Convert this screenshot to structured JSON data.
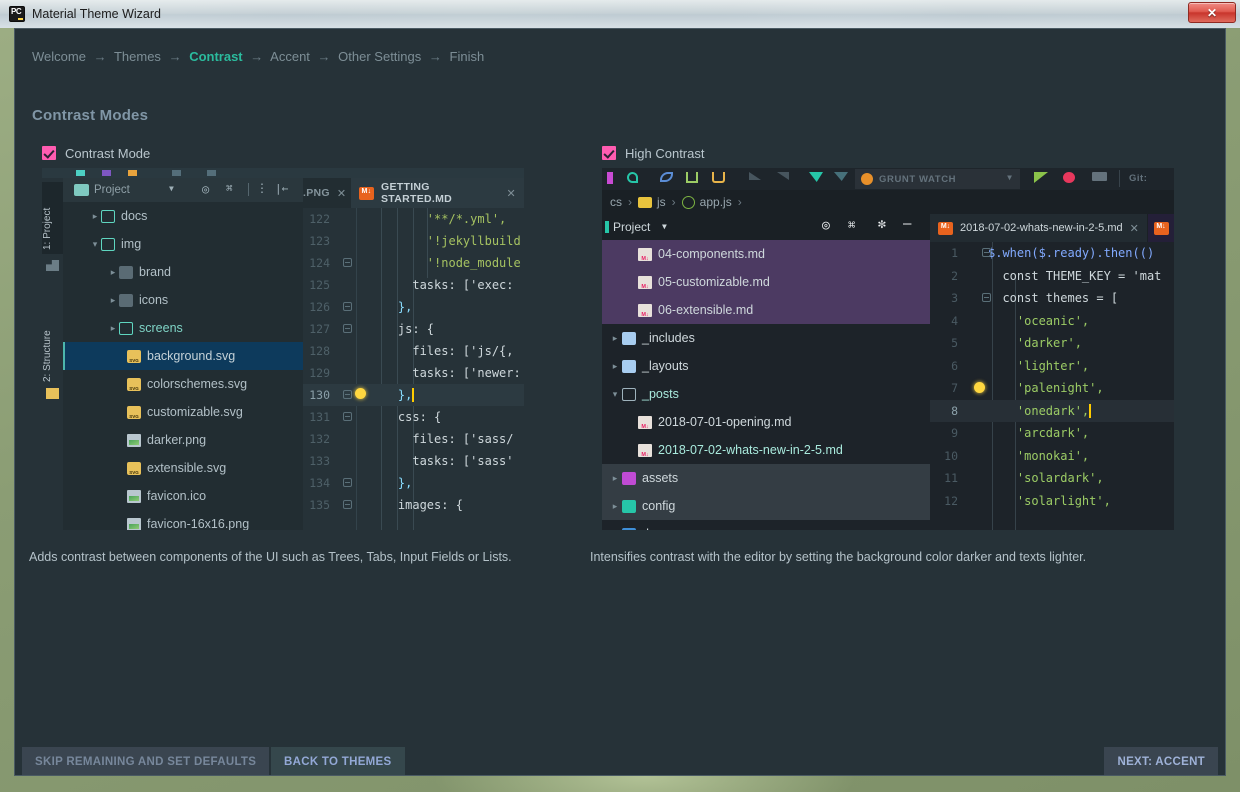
{
  "window": {
    "title": "Material Theme Wizard",
    "app_icon": "pycharm-icon",
    "close_label": "✕"
  },
  "breadcrumb": {
    "separator": "→",
    "steps": [
      {
        "label": "Welcome",
        "active": false
      },
      {
        "label": "Themes",
        "active": false
      },
      {
        "label": "Contrast",
        "active": true
      },
      {
        "label": "Accent",
        "active": false
      },
      {
        "label": "Other Settings",
        "active": false
      },
      {
        "label": "Finish",
        "active": false
      }
    ]
  },
  "page_title": "Contrast Modes",
  "options": [
    {
      "id": "contrast-mode",
      "label": "Contrast Mode",
      "checked": true,
      "description": "Adds contrast between components of the UI such as Trees, Tabs, Input Fields or Lists."
    },
    {
      "id": "high-contrast",
      "label": "High Contrast",
      "checked": true,
      "description": "Intensifies contrast with the editor by setting the background color darker and texts lighter."
    }
  ],
  "footer": {
    "skip": "SKIP REMAINING AND SET DEFAULTS",
    "back": "BACK TO THEMES",
    "next": "NEXT: ACCENT"
  },
  "preview_left": {
    "tool_window_tabs": [
      "1: Project",
      "2: Structure"
    ],
    "project_panel": {
      "title": "Project",
      "dropdown_icon": "chevron-down-icon",
      "toolbar_icons": [
        "target-icon",
        "collapse-all-icon",
        "more-options-icon",
        "hide-icon"
      ],
      "tree": [
        {
          "name": "docs",
          "arrow": "▸",
          "icon": "folder-outline-teal",
          "indent": 1,
          "selected": false
        },
        {
          "name": "img",
          "arrow": "▾",
          "icon": "folder-outline-teal",
          "indent": 1,
          "selected": false
        },
        {
          "name": "brand",
          "arrow": "▸",
          "icon": "folder-solid-grey",
          "indent": 2,
          "selected": false
        },
        {
          "name": "icons",
          "arrow": "▸",
          "icon": "folder-solid-grey",
          "indent": 2,
          "selected": false
        },
        {
          "name": "screens",
          "arrow": "▸",
          "icon": "folder-outline-teal",
          "indent": 2,
          "selected": false
        },
        {
          "name": "background.svg",
          "arrow": "",
          "icon": "svg-file-icon",
          "indent": 3,
          "selected": true
        },
        {
          "name": "colorschemes.svg",
          "arrow": "",
          "icon": "svg-file-icon",
          "indent": 3,
          "selected": false
        },
        {
          "name": "customizable.svg",
          "arrow": "",
          "icon": "svg-file-icon",
          "indent": 3,
          "selected": false
        },
        {
          "name": "darker.png",
          "arrow": "",
          "icon": "image-file-icon",
          "indent": 3,
          "selected": false
        },
        {
          "name": "extensible.svg",
          "arrow": "",
          "icon": "svg-file-icon",
          "indent": 3,
          "selected": false
        },
        {
          "name": "favicon.ico",
          "arrow": "",
          "icon": "image-file-icon",
          "indent": 3,
          "selected": false
        },
        {
          "name": "favicon-16x16.png",
          "arrow": "",
          "icon": "image-file-icon",
          "indent": 3,
          "selected": false
        }
      ]
    },
    "editor": {
      "tabs": [
        {
          "label": ".PNG",
          "active": false,
          "icon": "",
          "close": "✕"
        },
        {
          "label": "GETTING STARTED.MD",
          "active": true,
          "icon": "markdown-icon",
          "close": "✕"
        }
      ],
      "lines": [
        {
          "num": "122",
          "text": "        '**/*.yml',",
          "fold": false,
          "bulb": false,
          "highlight": false
        },
        {
          "num": "123",
          "text": "        '!jekyllbuild",
          "fold": false,
          "bulb": false,
          "highlight": false
        },
        {
          "num": "124",
          "text": "        '!node_module",
          "fold": true,
          "bulb": false,
          "highlight": false
        },
        {
          "num": "125",
          "text": "      tasks: ['exec:",
          "fold": false,
          "bulb": false,
          "highlight": false
        },
        {
          "num": "126",
          "text": "    },",
          "fold": true,
          "bulb": false,
          "highlight": false
        },
        {
          "num": "127",
          "text": "    js: {",
          "fold": true,
          "bulb": false,
          "highlight": false
        },
        {
          "num": "128",
          "text": "      files: ['js/{,",
          "fold": false,
          "bulb": false,
          "highlight": false
        },
        {
          "num": "129",
          "text": "      tasks: ['newer:",
          "fold": false,
          "bulb": false,
          "highlight": false
        },
        {
          "num": "130",
          "text": "    },",
          "fold": true,
          "bulb": true,
          "highlight": true
        },
        {
          "num": "131",
          "text": "    css: {",
          "fold": true,
          "bulb": false,
          "highlight": false
        },
        {
          "num": "132",
          "text": "      files: ['sass/",
          "fold": false,
          "bulb": false,
          "highlight": false
        },
        {
          "num": "133",
          "text": "      tasks: ['sass'",
          "fold": false,
          "bulb": false,
          "highlight": false
        },
        {
          "num": "134",
          "text": "    },",
          "fold": true,
          "bulb": false,
          "highlight": false
        },
        {
          "num": "135",
          "text": "    images: {",
          "fold": true,
          "bulb": false,
          "highlight": false
        }
      ]
    }
  },
  "preview_right": {
    "toolbar": {
      "run_config_label": "GRUNT WATCH",
      "run_config_dropdown": "chevron-down-icon",
      "vcs_label": "Git:"
    },
    "breadcrumb_path": [
      "cs",
      "js",
      "app.js"
    ],
    "project_panel": {
      "title": "Project",
      "dropdown_icon": "chevron-down-icon",
      "toolbar_icons": [
        "target-icon",
        "collapse-all-icon",
        "settings-gear-icon",
        "minimize-icon"
      ],
      "tree": [
        {
          "name": "04-components.md",
          "arrow": "",
          "icon": "markdown-file-icon",
          "indent": 2,
          "state": "selected-purple"
        },
        {
          "name": "05-customizable.md",
          "arrow": "",
          "icon": "markdown-file-icon",
          "indent": 2,
          "state": "selected-purple"
        },
        {
          "name": "06-extensible.md",
          "arrow": "",
          "icon": "markdown-file-icon",
          "indent": 2,
          "state": "selected-purple"
        },
        {
          "name": "_includes",
          "arrow": "▸",
          "icon": "folder-blue-icon",
          "indent": 1,
          "state": "none"
        },
        {
          "name": "_layouts",
          "arrow": "▸",
          "icon": "folder-blue-icon",
          "indent": 1,
          "state": "none"
        },
        {
          "name": "_posts",
          "arrow": "▾",
          "icon": "folder-outline-icon",
          "indent": 1,
          "state": "none"
        },
        {
          "name": "2018-07-01-opening.md",
          "arrow": "",
          "icon": "markdown-file-icon",
          "indent": 2,
          "state": "none"
        },
        {
          "name": "2018-07-02-whats-new-in-2-5.md",
          "arrow": "",
          "icon": "markdown-file-icon",
          "indent": 2,
          "state": "none"
        },
        {
          "name": "assets",
          "arrow": "▸",
          "icon": "folder-magenta-icon",
          "indent": 1,
          "state": "hover-grey"
        },
        {
          "name": "config",
          "arrow": "▸",
          "icon": "folder-teal-icon",
          "indent": 1,
          "state": "hover-grey"
        },
        {
          "name": "docs",
          "arrow": "▸",
          "icon": "folder-docs-icon",
          "indent": 1,
          "state": "none"
        }
      ]
    },
    "editor": {
      "tabs": [
        {
          "label": "2018-07-02-whats-new-in-2-5.md",
          "active": true,
          "icon": "markdown-icon",
          "close": "✕"
        },
        {
          "label": "",
          "active": false,
          "icon": "markdown-icon",
          "close": ""
        }
      ],
      "lines": [
        {
          "num": "1",
          "text": "$.when($.ready).then(()",
          "fold": true,
          "bulb": false,
          "highlight": false
        },
        {
          "num": "2",
          "text": "  const THEME_KEY = 'mat",
          "fold": false,
          "bulb": false,
          "highlight": false
        },
        {
          "num": "3",
          "text": "  const themes = [",
          "fold": true,
          "bulb": false,
          "highlight": false
        },
        {
          "num": "4",
          "text": "    'oceanic',",
          "fold": false,
          "bulb": false,
          "highlight": false
        },
        {
          "num": "5",
          "text": "    'darker',",
          "fold": false,
          "bulb": false,
          "highlight": false
        },
        {
          "num": "6",
          "text": "    'lighter',",
          "fold": false,
          "bulb": false,
          "highlight": false
        },
        {
          "num": "7",
          "text": "    'palenight',",
          "fold": false,
          "bulb": true,
          "highlight": false
        },
        {
          "num": "8",
          "text": "    'onedark',",
          "fold": false,
          "bulb": false,
          "highlight": true
        },
        {
          "num": "9",
          "text": "    'arcdark',",
          "fold": false,
          "bulb": false,
          "highlight": false
        },
        {
          "num": "10",
          "text": "    'monokai',",
          "fold": false,
          "bulb": false,
          "highlight": false
        },
        {
          "num": "11",
          "text": "    'solardark',",
          "fold": false,
          "bulb": false,
          "highlight": false
        },
        {
          "num": "12",
          "text": "    'solarlight',",
          "fold": false,
          "bulb": false,
          "highlight": false
        }
      ]
    }
  },
  "colors": {
    "dialog_bg": "#263238",
    "accent_active_step": "#2bbb9d",
    "checkbox": "#ff5cb0",
    "title_text": "#8096a6",
    "selection_blue": "#0d3a5c",
    "selection_purple": "#4c3a62"
  }
}
